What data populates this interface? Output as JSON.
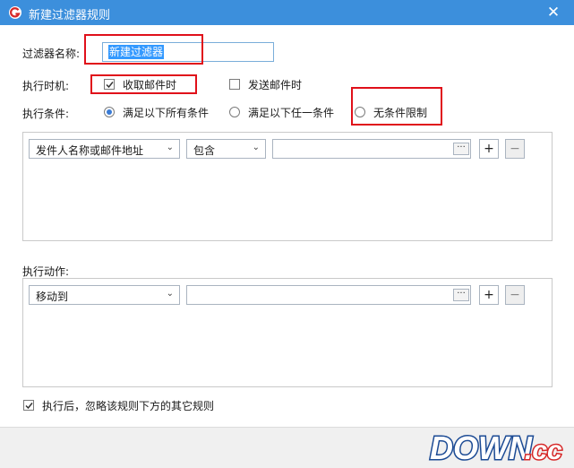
{
  "window": {
    "title": "新建过滤器规则",
    "close_glyph": "✕"
  },
  "form": {
    "name_label": "过滤器名称:",
    "name_value": "新建过滤器",
    "timing_label": "执行时机:",
    "timing_options": [
      {
        "label": "收取邮件时",
        "checked": true
      },
      {
        "label": "发送邮件时",
        "checked": false
      }
    ],
    "condition_label": "执行条件:",
    "condition_options": [
      {
        "label": "满足以下所有条件",
        "selected": true
      },
      {
        "label": "满足以下任一条件",
        "selected": false
      },
      {
        "label": "无条件限制",
        "selected": false
      }
    ]
  },
  "conditions": {
    "field": "发件人名称或邮件地址",
    "operator": "包含",
    "value": "",
    "more_label": "···",
    "add_label": "+",
    "remove_label": "−"
  },
  "actions": {
    "label": "执行动作:",
    "action": "移动到",
    "target": "",
    "more_label": "···",
    "add_label": "+",
    "remove_label": "−"
  },
  "ignore_rules": {
    "label": "执行后，忽略该规则下方的其它规则",
    "checked": true
  },
  "watermark": {
    "text": "DOWN",
    "suffix": ".cc"
  },
  "colors": {
    "titlebar": "#3c8fdc",
    "highlight": "#e0101a",
    "accent": "#3a7bd5"
  }
}
